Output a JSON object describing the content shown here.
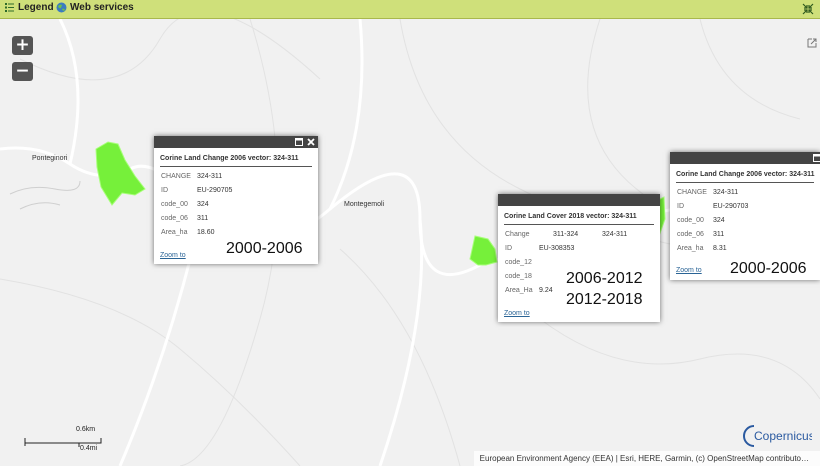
{
  "toolbar": {
    "legend_label": "Legend",
    "webservices_label": "Web services"
  },
  "map": {
    "zoom_in": "+",
    "zoom_out": "−"
  },
  "places": {
    "ponteginori": "Ponteginori",
    "montegemoli": "Montegemoli"
  },
  "popup1": {
    "title": "Corine Land Change 2006 vector: 324-311",
    "rows": [
      [
        "CHANGE",
        "324-311"
      ],
      [
        "ID",
        "EU-290705"
      ],
      [
        "code_00",
        "324"
      ],
      [
        "code_06",
        "311"
      ],
      [
        "Area_ha",
        "18.60"
      ]
    ],
    "zoom_label": "Zoom to",
    "annotation": "2000-2006"
  },
  "popup2": {
    "title": "Corine Land Cover 2018 vector: 324-311",
    "rows": [
      [
        "Change",
        "311-324"
      ],
      [
        "ID",
        "EU-308353"
      ],
      [
        "code_12",
        ""
      ],
      [
        "code_18",
        ""
      ],
      [
        "Area_Ha",
        "9.24"
      ]
    ],
    "change_extra": "324-311",
    "zoom_label": "Zoom to",
    "annotation_a": "2006-2012",
    "annotation_b": "2012-2018"
  },
  "popup3": {
    "title": "Corine Land Change 2006 vector: 324-311",
    "rows": [
      [
        "CHANGE",
        "324-311"
      ],
      [
        "ID",
        "EU-290703"
      ],
      [
        "code_00",
        "324"
      ],
      [
        "code_06",
        "311"
      ],
      [
        "Area_ha",
        "8.31"
      ]
    ],
    "zoom_label": "Zoom to",
    "annotation": "2000-2006"
  },
  "scale": {
    "km": "0.6km",
    "mi": "0.4mi"
  },
  "logo": "Copernicus",
  "attribution": "European Environment Agency (EEA) | Esri, HERE, Garmin, (c) OpenStreetMap contributo…",
  "colors": {
    "polygon": "#76f03a",
    "toolbar": "#cfe07a"
  }
}
